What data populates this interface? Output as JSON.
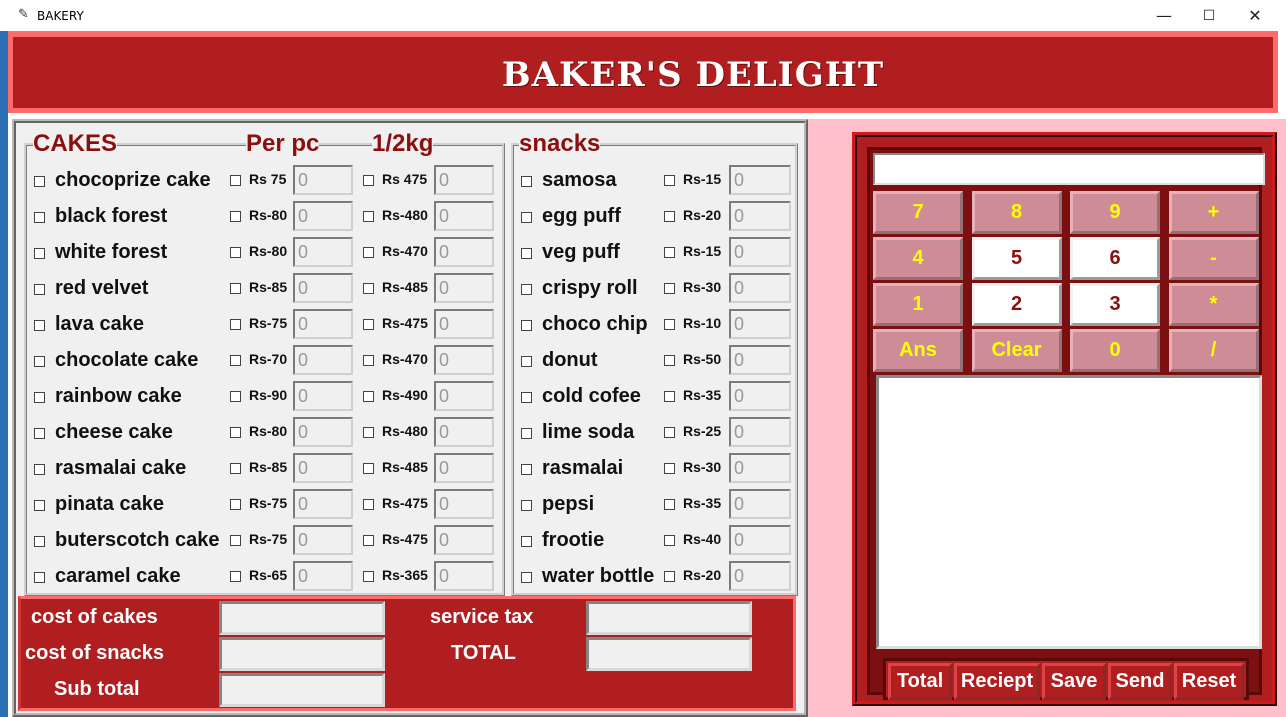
{
  "window": {
    "title": "BAKERY",
    "minimize": "—",
    "maximize": "☐",
    "close": "✕"
  },
  "header": {
    "title": "BAKER'S DELIGHT"
  },
  "cakes": {
    "title": "CAKES",
    "col_perpc": "Per pc",
    "col_halfkg": "1/2kg",
    "items": [
      {
        "name": "chocoprize cake",
        "per_pc": "Rs 75",
        "half_kg": "Rs 475",
        "qty1": "0",
        "qty2": "0"
      },
      {
        "name": "black forest",
        "per_pc": "Rs-80",
        "half_kg": "Rs-480",
        "qty1": "0",
        "qty2": "0"
      },
      {
        "name": "white forest",
        "per_pc": "Rs-80",
        "half_kg": "Rs-470",
        "qty1": "0",
        "qty2": "0"
      },
      {
        "name": "red velvet",
        "per_pc": "Rs-85",
        "half_kg": "Rs-485",
        "qty1": "0",
        "qty2": "0"
      },
      {
        "name": "lava cake",
        "per_pc": "Rs-75",
        "half_kg": "Rs-475",
        "qty1": "0",
        "qty2": "0"
      },
      {
        "name": "chocolate cake",
        "per_pc": "Rs-70",
        "half_kg": "Rs-470",
        "qty1": "0",
        "qty2": "0"
      },
      {
        "name": "rainbow cake",
        "per_pc": "Rs-90",
        "half_kg": "Rs-490",
        "qty1": "0",
        "qty2": "0"
      },
      {
        "name": "cheese cake",
        "per_pc": "Rs-80",
        "half_kg": "Rs-480",
        "qty1": "0",
        "qty2": "0"
      },
      {
        "name": "rasmalai cake",
        "per_pc": "Rs-85",
        "half_kg": "Rs-485",
        "qty1": "0",
        "qty2": "0"
      },
      {
        "name": "pinata cake",
        "per_pc": "Rs-75",
        "half_kg": "Rs-475",
        "qty1": "0",
        "qty2": "0"
      },
      {
        "name": "buterscotch cake",
        "per_pc": "Rs-75",
        "half_kg": "Rs-475",
        "qty1": "0",
        "qty2": "0"
      },
      {
        "name": "caramel cake",
        "per_pc": "Rs-65",
        "half_kg": "Rs-365",
        "qty1": "0",
        "qty2": "0"
      }
    ]
  },
  "snacks": {
    "title": "snacks",
    "items": [
      {
        "name": "samosa",
        "price": "Rs-15",
        "qty": "0"
      },
      {
        "name": "egg puff",
        "price": "Rs-20",
        "qty": "0"
      },
      {
        "name": "veg puff",
        "price": "Rs-15",
        "qty": "0"
      },
      {
        "name": "crispy roll",
        "price": "Rs-30",
        "qty": "0"
      },
      {
        "name": "choco chip",
        "price": "Rs-10",
        "qty": "0"
      },
      {
        "name": "donut",
        "price": "Rs-50",
        "qty": "0"
      },
      {
        "name": "cold cofee",
        "price": "Rs-35",
        "qty": "0"
      },
      {
        "name": "lime soda",
        "price": "Rs-25",
        "qty": "0"
      },
      {
        "name": "rasmalai",
        "price": "Rs-30",
        "qty": "0"
      },
      {
        "name": "pepsi",
        "price": "Rs-35",
        "qty": "0"
      },
      {
        "name": "frootie",
        "price": "Rs-40",
        "qty": "0"
      },
      {
        "name": "water bottle",
        "price": "Rs-20",
        "qty": "0"
      }
    ]
  },
  "costs": {
    "cost_cakes": "cost of cakes",
    "cost_snacks": "cost of snacks",
    "sub_total": "Sub total",
    "service_tax": "service tax",
    "total": "TOTAL"
  },
  "calculator": {
    "keys": [
      {
        "label": "7",
        "style": "pink"
      },
      {
        "label": "8",
        "style": "pink"
      },
      {
        "label": "9",
        "style": "pink"
      },
      {
        "label": "+",
        "style": "pink"
      },
      {
        "label": "4",
        "style": "pink"
      },
      {
        "label": "5",
        "style": "white"
      },
      {
        "label": "6",
        "style": "white"
      },
      {
        "label": "-",
        "style": "pink"
      },
      {
        "label": "1",
        "style": "pink"
      },
      {
        "label": "2",
        "style": "white"
      },
      {
        "label": "3",
        "style": "white"
      },
      {
        "label": "*",
        "style": "pink"
      },
      {
        "label": "Ans",
        "style": "pink"
      },
      {
        "label": "Clear",
        "style": "pink"
      },
      {
        "label": "0",
        "style": "pink"
      },
      {
        "label": "/",
        "style": "pink"
      }
    ]
  },
  "actions": {
    "total": "Total",
    "receipt": "Reciept",
    "save": "Save",
    "send": "Send",
    "reset": "Reset"
  },
  "colors": {
    "header_red": "#b01e1f",
    "border_pink": "#ff6b6b",
    "panel_pink": "#ffc0cb",
    "key_pink": "#cd8c96",
    "key_text": "#ffff00",
    "title_red": "#8b0f0f"
  }
}
